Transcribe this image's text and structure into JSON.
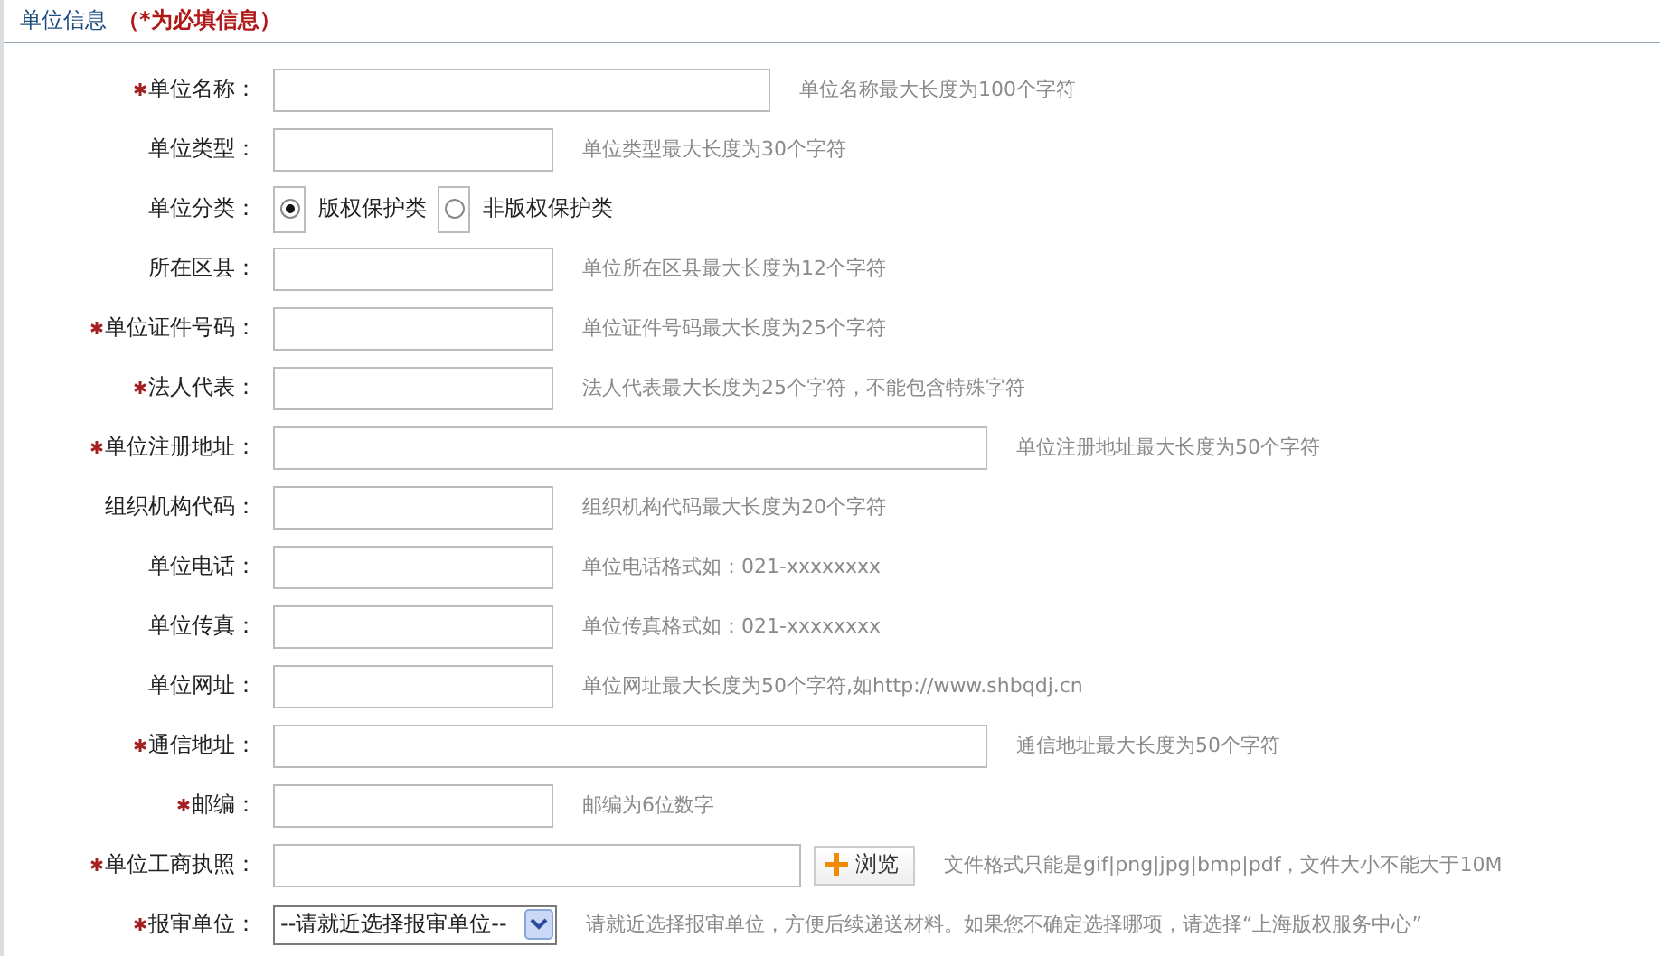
{
  "section": {
    "title": "单位信息",
    "note": "（*为必填信息）"
  },
  "rows": [
    {
      "kind": "medium",
      "label": "单位名称：",
      "required": true,
      "hint": "单位名称最大长度为100个字符"
    },
    {
      "kind": "short",
      "label": "单位类型：",
      "required": false,
      "hint": "单位类型最大长度为30个字符"
    },
    {
      "kind": "radio",
      "label": "单位分类：",
      "required": false,
      "options": [
        {
          "label": "版权保护类",
          "selected": true
        },
        {
          "label": "非版权保护类",
          "selected": false
        }
      ]
    },
    {
      "kind": "short",
      "label": "所在区县：",
      "required": false,
      "hint": "单位所在区县最大长度为12个字符"
    },
    {
      "kind": "short",
      "label": "单位证件号码：",
      "required": true,
      "hint": "单位证件号码最大长度为25个字符"
    },
    {
      "kind": "short",
      "label": "法人代表：",
      "required": true,
      "hint": "法人代表最大长度为25个字符，不能包含特殊字符"
    },
    {
      "kind": "long",
      "label": "单位注册地址：",
      "required": true,
      "hint": "单位注册地址最大长度为50个字符"
    },
    {
      "kind": "short",
      "label": "组织机构代码：",
      "required": false,
      "hint": "组织机构代码最大长度为20个字符"
    },
    {
      "kind": "short",
      "label": "单位电话：",
      "required": false,
      "hint": "单位电话格式如：021-xxxxxxxx"
    },
    {
      "kind": "short",
      "label": "单位传真：",
      "required": false,
      "hint": "单位传真格式如：021-xxxxxxxx"
    },
    {
      "kind": "short",
      "label": "单位网址：",
      "required": false,
      "hint": "单位网址最大长度为50个字符,如http://www.shbqdj.cn"
    },
    {
      "kind": "long",
      "label": "通信地址：",
      "required": true,
      "hint": "通信地址最大长度为50个字符"
    },
    {
      "kind": "short",
      "label": "邮编：",
      "required": true,
      "hint": "邮编为6位数字"
    },
    {
      "kind": "file",
      "label": "单位工商执照：",
      "required": true,
      "button": "浏览",
      "hint": "文件格式只能是gif|png|jpg|bmp|pdf，文件大小不能大于10M"
    },
    {
      "kind": "select",
      "label": "报审单位：",
      "required": true,
      "value": "--请就近选择报审单位--",
      "hint": "请就近选择报审单位，方便后续递送材料。如果您不确定选择哪项，请选择“上海版权服务中心”"
    }
  ]
}
